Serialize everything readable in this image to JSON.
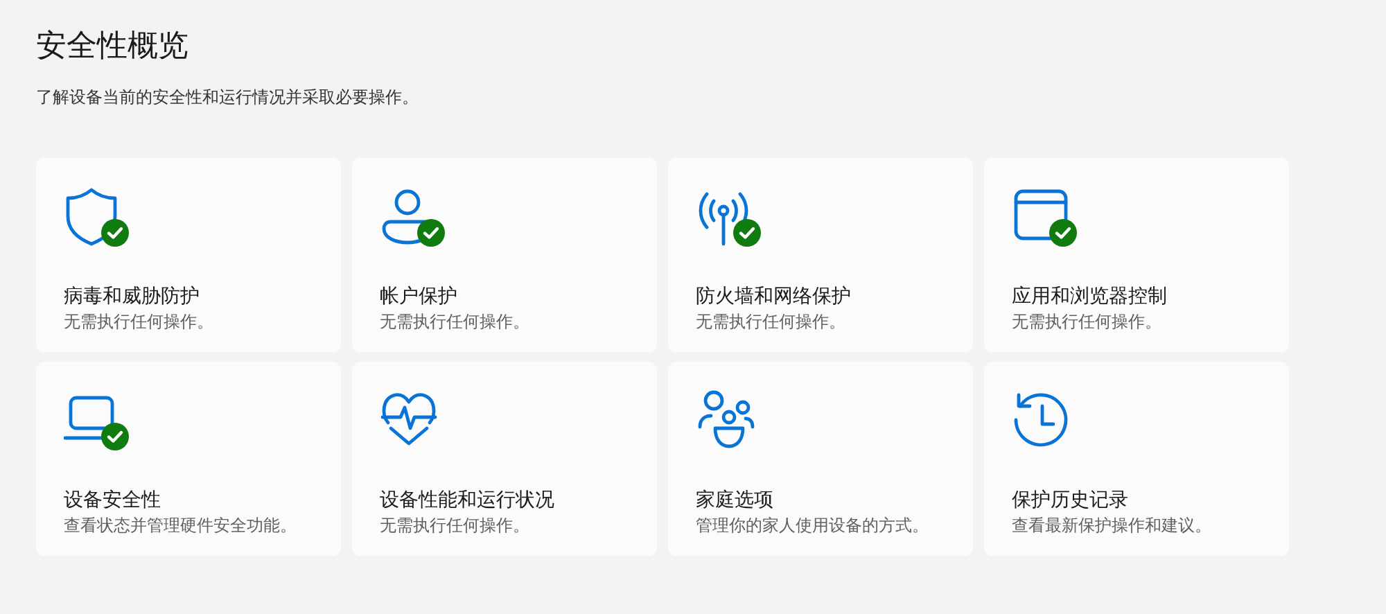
{
  "title": "安全性概览",
  "subtitle": "了解设备当前的安全性和运行情况并采取必要操作。",
  "tiles": [
    {
      "kind": "shield",
      "title": "病毒和威胁防护",
      "description": "无需执行任何操作。",
      "ok": true
    },
    {
      "kind": "person",
      "title": "帐户保护",
      "description": "无需执行任何操作。",
      "ok": true
    },
    {
      "kind": "antenna",
      "title": "防火墙和网络保护",
      "description": "无需执行任何操作。",
      "ok": true
    },
    {
      "kind": "window",
      "title": "应用和浏览器控制",
      "description": "无需执行任何操作。",
      "ok": true
    },
    {
      "kind": "laptop",
      "title": "设备安全性",
      "description": "查看状态并管理硬件安全功能。",
      "ok": true
    },
    {
      "kind": "heart",
      "title": "设备性能和运行状况",
      "description": "无需执行任何操作。",
      "ok": false
    },
    {
      "kind": "family",
      "title": "家庭选项",
      "description": "管理你的家人使用设备的方式。",
      "ok": false
    },
    {
      "kind": "history",
      "title": "保护历史记录",
      "description": "查看最新保护操作和建议。",
      "ok": false
    }
  ]
}
